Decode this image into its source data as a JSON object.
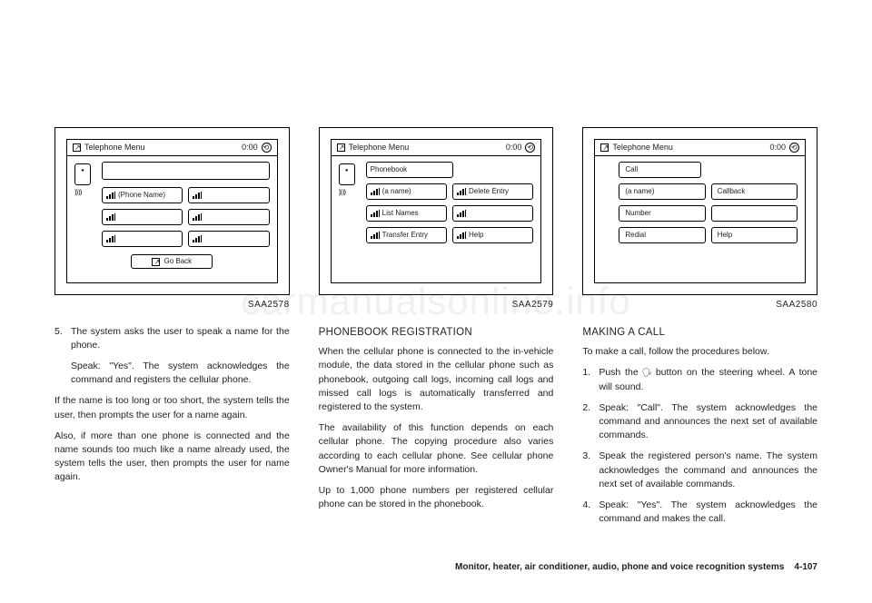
{
  "screens": {
    "s1": {
      "title": "Telephone Menu",
      "time": "0:00",
      "phoneName": "(Phone Name)",
      "goBack": "Go Back",
      "caption": "SAA2578"
    },
    "s2": {
      "title": "Telephone Menu",
      "time": "0:00",
      "r1": "Phonebook",
      "r2a": "(a name)",
      "r2b": "Delete Entry",
      "r3a": "List Names",
      "r3b": "",
      "r4a": "Transfer Entry",
      "r4b": "Help",
      "caption": "SAA2579"
    },
    "s3": {
      "title": "Telephone Menu",
      "time": "0:00",
      "r1": "Call",
      "r2a": "(a name)",
      "r2b": "Callback",
      "r3a": "Number",
      "r3b": "",
      "r4a": "Redial",
      "r4b": "Help",
      "caption": "SAA2580"
    }
  },
  "col1": {
    "li5": "The system asks the user to speak a name for the phone.",
    "li5b": "Speak: \"Yes\". The system acknowledges the command and registers the cellular phone.",
    "p1": "If the name is too long or too short, the system tells the user, then prompts the user for a name again.",
    "p2": "Also, if more than one phone is connected and the name sounds too much like a name already used, the system tells the user, then prompts the user for name again."
  },
  "col2": {
    "h": "PHONEBOOK REGISTRATION",
    "p1": "When the cellular phone is connected to the in-vehicle module, the data stored in the cellular phone such as phonebook, outgoing call logs, incoming call logs and missed call logs is automatically transferred and registered to the system.",
    "p2": "The availability of this function depends on each cellular phone. The copying procedure also varies according to each cellular phone. See cellular phone Owner's Manual for more information.",
    "p3": "Up to 1,000 phone numbers per registered cellular phone can be stored in the phonebook."
  },
  "col3": {
    "h": "MAKING A CALL",
    "intro": "To make a call, follow the procedures below.",
    "li1a": "Push the",
    "li1b": "button on the steering wheel. A tone will sound.",
    "li2": "Speak: \"Call\". The system acknowledges the command and announces the next set of available commands.",
    "li3": "Speak the registered person's name. The system acknowledges the command and announces the next set of available commands.",
    "li4": "Speak: \"Yes\". The system acknowledges the command and makes the call."
  },
  "footer": {
    "section": "Monitor, heater, air conditioner, audio, phone and voice recognition systems",
    "page": "4-107"
  },
  "watermark": "carmanualsonline.info"
}
